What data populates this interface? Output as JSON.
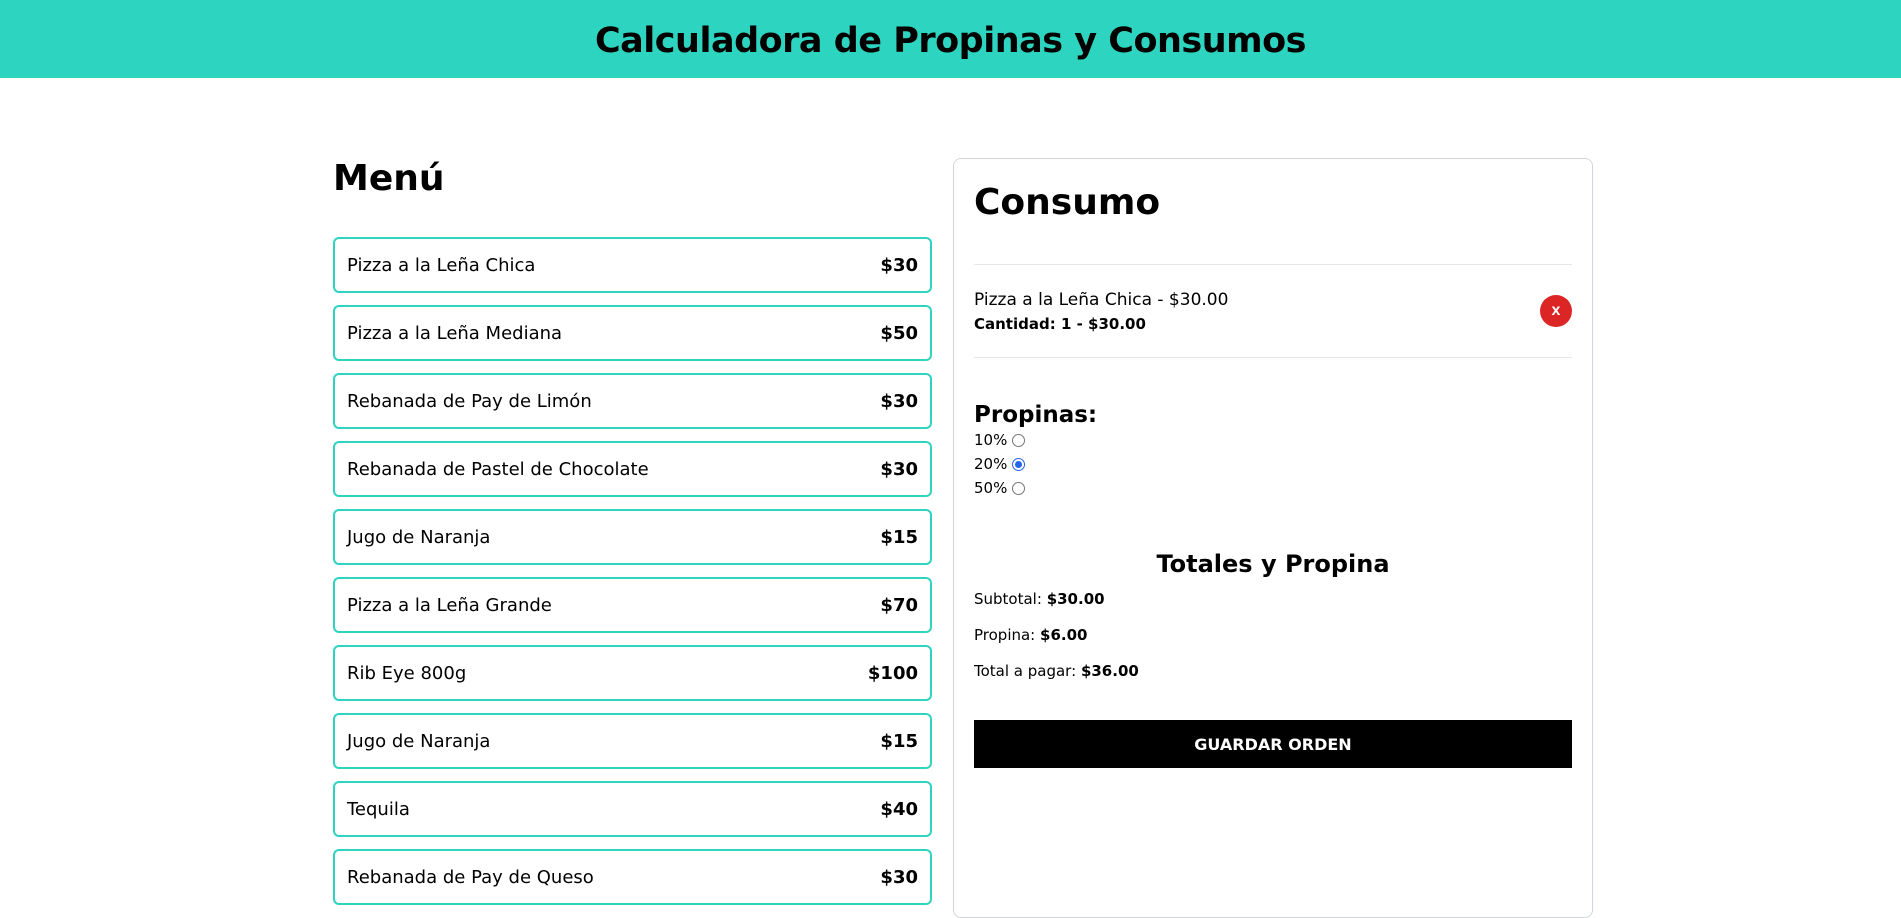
{
  "header": {
    "title": "Calculadora de Propinas y Consumos"
  },
  "menu": {
    "title": "Menú",
    "items": [
      {
        "name": "Pizza a la Leña Chica",
        "price": "$30"
      },
      {
        "name": "Pizza a la Leña Mediana",
        "price": "$50"
      },
      {
        "name": "Rebanada de Pay de Limón",
        "price": "$30"
      },
      {
        "name": "Rebanada de Pastel de Chocolate",
        "price": "$30"
      },
      {
        "name": "Jugo de Naranja",
        "price": "$15"
      },
      {
        "name": "Pizza a la Leña Grande",
        "price": "$70"
      },
      {
        "name": "Rib Eye 800g",
        "price": "$100"
      },
      {
        "name": "Jugo de Naranja",
        "price": "$15"
      },
      {
        "name": "Tequila",
        "price": "$40"
      },
      {
        "name": "Rebanada de Pay de Queso",
        "price": "$30"
      }
    ]
  },
  "order": {
    "title": "Consumo",
    "items": [
      {
        "name": "Pizza a la Leña Chica - $30.00",
        "qty": "Cantidad: 1 - $30.00",
        "remove_label": "x"
      }
    ],
    "tips": {
      "title": "Propinas:",
      "options": [
        {
          "label": "10%",
          "checked": false
        },
        {
          "label": "20%",
          "checked": true
        },
        {
          "label": "50%",
          "checked": false
        }
      ]
    },
    "totals": {
      "title": "Totales y Propina",
      "subtotal_label": "Subtotal:",
      "subtotal_value": "$30.00",
      "tip_label": "Propina:",
      "tip_value": "$6.00",
      "total_label": "Total a pagar:",
      "total_value": "$36.00"
    },
    "save_label": "GUARDAR ORDEN"
  },
  "colors": {
    "accent": "#2dd4bf",
    "remove": "#dc2626",
    "radio_checked": "#2563eb"
  }
}
